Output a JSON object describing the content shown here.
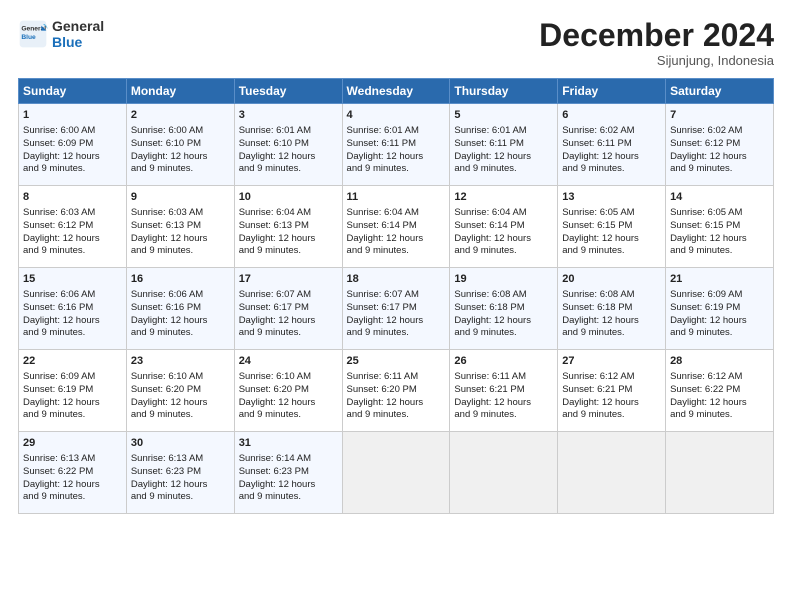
{
  "header": {
    "logo_line1": "General",
    "logo_line2": "Blue",
    "month": "December 2024",
    "location": "Sijunjung, Indonesia"
  },
  "days_of_week": [
    "Sunday",
    "Monday",
    "Tuesday",
    "Wednesday",
    "Thursday",
    "Friday",
    "Saturday"
  ],
  "weeks": [
    [
      {
        "day": 1,
        "lines": [
          "Sunrise: 6:00 AM",
          "Sunset: 6:09 PM",
          "Daylight: 12 hours",
          "and 9 minutes."
        ]
      },
      {
        "day": 2,
        "lines": [
          "Sunrise: 6:00 AM",
          "Sunset: 6:10 PM",
          "Daylight: 12 hours",
          "and 9 minutes."
        ]
      },
      {
        "day": 3,
        "lines": [
          "Sunrise: 6:01 AM",
          "Sunset: 6:10 PM",
          "Daylight: 12 hours",
          "and 9 minutes."
        ]
      },
      {
        "day": 4,
        "lines": [
          "Sunrise: 6:01 AM",
          "Sunset: 6:11 PM",
          "Daylight: 12 hours",
          "and 9 minutes."
        ]
      },
      {
        "day": 5,
        "lines": [
          "Sunrise: 6:01 AM",
          "Sunset: 6:11 PM",
          "Daylight: 12 hours",
          "and 9 minutes."
        ]
      },
      {
        "day": 6,
        "lines": [
          "Sunrise: 6:02 AM",
          "Sunset: 6:11 PM",
          "Daylight: 12 hours",
          "and 9 minutes."
        ]
      },
      {
        "day": 7,
        "lines": [
          "Sunrise: 6:02 AM",
          "Sunset: 6:12 PM",
          "Daylight: 12 hours",
          "and 9 minutes."
        ]
      }
    ],
    [
      {
        "day": 8,
        "lines": [
          "Sunrise: 6:03 AM",
          "Sunset: 6:12 PM",
          "Daylight: 12 hours",
          "and 9 minutes."
        ]
      },
      {
        "day": 9,
        "lines": [
          "Sunrise: 6:03 AM",
          "Sunset: 6:13 PM",
          "Daylight: 12 hours",
          "and 9 minutes."
        ]
      },
      {
        "day": 10,
        "lines": [
          "Sunrise: 6:04 AM",
          "Sunset: 6:13 PM",
          "Daylight: 12 hours",
          "and 9 minutes."
        ]
      },
      {
        "day": 11,
        "lines": [
          "Sunrise: 6:04 AM",
          "Sunset: 6:14 PM",
          "Daylight: 12 hours",
          "and 9 minutes."
        ]
      },
      {
        "day": 12,
        "lines": [
          "Sunrise: 6:04 AM",
          "Sunset: 6:14 PM",
          "Daylight: 12 hours",
          "and 9 minutes."
        ]
      },
      {
        "day": 13,
        "lines": [
          "Sunrise: 6:05 AM",
          "Sunset: 6:15 PM",
          "Daylight: 12 hours",
          "and 9 minutes."
        ]
      },
      {
        "day": 14,
        "lines": [
          "Sunrise: 6:05 AM",
          "Sunset: 6:15 PM",
          "Daylight: 12 hours",
          "and 9 minutes."
        ]
      }
    ],
    [
      {
        "day": 15,
        "lines": [
          "Sunrise: 6:06 AM",
          "Sunset: 6:16 PM",
          "Daylight: 12 hours",
          "and 9 minutes."
        ]
      },
      {
        "day": 16,
        "lines": [
          "Sunrise: 6:06 AM",
          "Sunset: 6:16 PM",
          "Daylight: 12 hours",
          "and 9 minutes."
        ]
      },
      {
        "day": 17,
        "lines": [
          "Sunrise: 6:07 AM",
          "Sunset: 6:17 PM",
          "Daylight: 12 hours",
          "and 9 minutes."
        ]
      },
      {
        "day": 18,
        "lines": [
          "Sunrise: 6:07 AM",
          "Sunset: 6:17 PM",
          "Daylight: 12 hours",
          "and 9 minutes."
        ]
      },
      {
        "day": 19,
        "lines": [
          "Sunrise: 6:08 AM",
          "Sunset: 6:18 PM",
          "Daylight: 12 hours",
          "and 9 minutes."
        ]
      },
      {
        "day": 20,
        "lines": [
          "Sunrise: 6:08 AM",
          "Sunset: 6:18 PM",
          "Daylight: 12 hours",
          "and 9 minutes."
        ]
      },
      {
        "day": 21,
        "lines": [
          "Sunrise: 6:09 AM",
          "Sunset: 6:19 PM",
          "Daylight: 12 hours",
          "and 9 minutes."
        ]
      }
    ],
    [
      {
        "day": 22,
        "lines": [
          "Sunrise: 6:09 AM",
          "Sunset: 6:19 PM",
          "Daylight: 12 hours",
          "and 9 minutes."
        ]
      },
      {
        "day": 23,
        "lines": [
          "Sunrise: 6:10 AM",
          "Sunset: 6:20 PM",
          "Daylight: 12 hours",
          "and 9 minutes."
        ]
      },
      {
        "day": 24,
        "lines": [
          "Sunrise: 6:10 AM",
          "Sunset: 6:20 PM",
          "Daylight: 12 hours",
          "and 9 minutes."
        ]
      },
      {
        "day": 25,
        "lines": [
          "Sunrise: 6:11 AM",
          "Sunset: 6:20 PM",
          "Daylight: 12 hours",
          "and 9 minutes."
        ]
      },
      {
        "day": 26,
        "lines": [
          "Sunrise: 6:11 AM",
          "Sunset: 6:21 PM",
          "Daylight: 12 hours",
          "and 9 minutes."
        ]
      },
      {
        "day": 27,
        "lines": [
          "Sunrise: 6:12 AM",
          "Sunset: 6:21 PM",
          "Daylight: 12 hours",
          "and 9 minutes."
        ]
      },
      {
        "day": 28,
        "lines": [
          "Sunrise: 6:12 AM",
          "Sunset: 6:22 PM",
          "Daylight: 12 hours",
          "and 9 minutes."
        ]
      }
    ],
    [
      {
        "day": 29,
        "lines": [
          "Sunrise: 6:13 AM",
          "Sunset: 6:22 PM",
          "Daylight: 12 hours",
          "and 9 minutes."
        ]
      },
      {
        "day": 30,
        "lines": [
          "Sunrise: 6:13 AM",
          "Sunset: 6:23 PM",
          "Daylight: 12 hours",
          "and 9 minutes."
        ]
      },
      {
        "day": 31,
        "lines": [
          "Sunrise: 6:14 AM",
          "Sunset: 6:23 PM",
          "Daylight: 12 hours",
          "and 9 minutes."
        ]
      },
      null,
      null,
      null,
      null
    ]
  ]
}
